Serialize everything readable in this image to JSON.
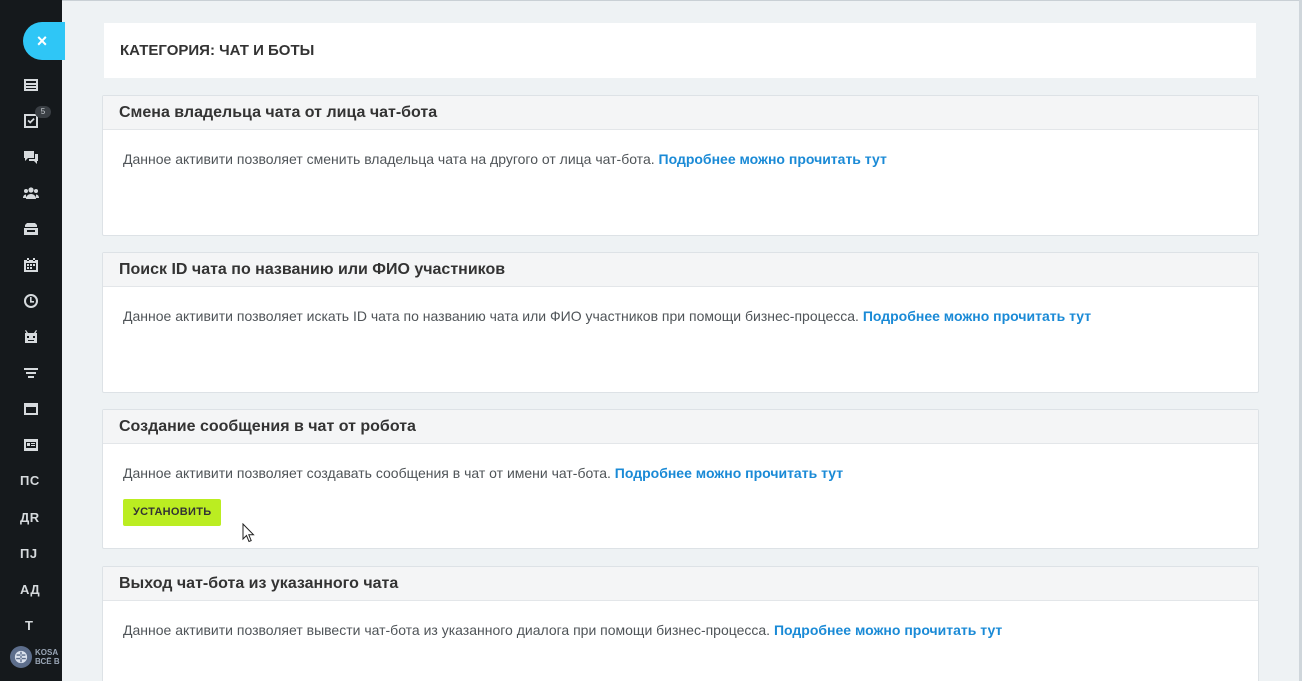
{
  "sidebar": {
    "close_label": "×",
    "badge": "5",
    "items": [
      {
        "icon": "newspaper-icon"
      },
      {
        "icon": "task-checklist-icon"
      },
      {
        "icon": "chat-icon"
      },
      {
        "icon": "users-group-icon"
      },
      {
        "icon": "crm-stack-icon"
      },
      {
        "icon": "calendar-icon"
      },
      {
        "icon": "clock-icon"
      },
      {
        "icon": "robot-icon"
      },
      {
        "icon": "filter-icon"
      },
      {
        "icon": "window-icon"
      },
      {
        "icon": "contact-card-icon"
      }
    ],
    "text_items": [
      "ПС",
      "ДR",
      "ПJ",
      "АД",
      "Т"
    ],
    "logo_text_1": "KOSA",
    "logo_text_2": "ВСЁ В"
  },
  "category_title": "КАТЕГОРИЯ: ЧАТ И БОТЫ",
  "cards": [
    {
      "title": "Смена владельца чата от лица чат-бота",
      "description": "Данное активити позволяет сменить владельца чата на другого от лица чат-бота.",
      "link": "Подробнее можно прочитать тут"
    },
    {
      "title": "Поиск ID чата по названию или ФИО участников",
      "description": "Данное активити позволяет искать ID чата по названию чата или ФИО участников при помощи бизнес-процесса.",
      "link": "Подробнее можно прочитать тут"
    },
    {
      "title": "Создание сообщения в чат от робота",
      "description": "Данное активити позволяет создавать сообщения в чат от имени чат-бота.",
      "link": "Подробнее можно прочитать тут",
      "button": "УСТАНОВИТЬ"
    },
    {
      "title": "Выход чат-бота из указанного чата",
      "description": "Данное активити позволяет вывести чат-бота из указанного диалога при помощи бизнес-процесса.",
      "link": "Подробнее можно прочитать тут"
    }
  ],
  "colors": {
    "accent_link": "#1a8ad6",
    "install_button": "#bbed21",
    "close_button": "#2fc6f6",
    "sidebar_bg": "#15191c"
  }
}
